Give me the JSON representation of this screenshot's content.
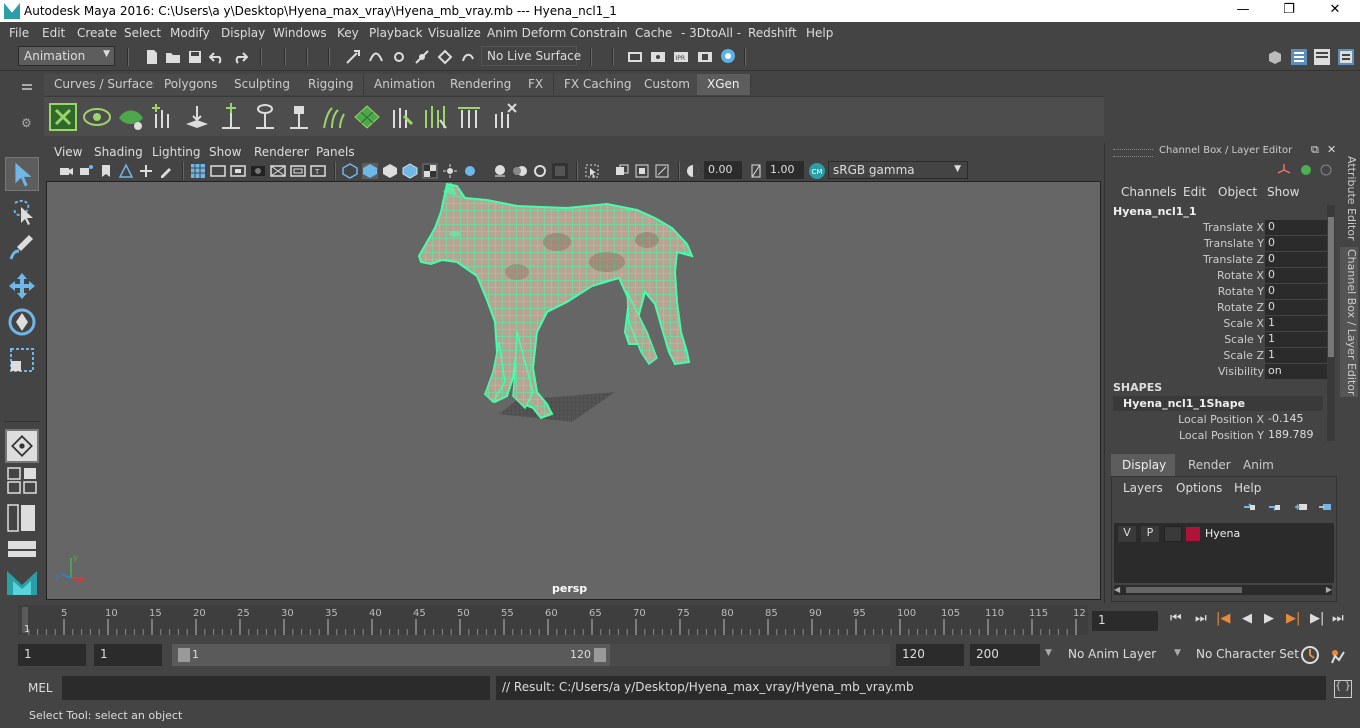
{
  "window": {
    "title": "Autodesk Maya 2016: C:\\Users\\a y\\Desktop\\Hyena_max_vray\\Hyena_mb_vray.mb   ---   Hyena_ncl1_1",
    "minimize": "—",
    "maximize": "❐",
    "close": "✕"
  },
  "menubar": {
    "items": [
      "File",
      "Edit",
      "Create",
      "Select",
      "Modify",
      "Display",
      "Windows",
      "Key",
      "Playback",
      "Visualize",
      "Anim Deform",
      "Constrain",
      "Cache",
      "- 3DtoAll -",
      "Redshift",
      "Help"
    ]
  },
  "statusline": {
    "menuset": "Animation",
    "live_surface": "No Live Surface"
  },
  "shelf": {
    "tabs": [
      "Curves / Surfaces",
      "Polygons",
      "Sculpting",
      "Rigging",
      "Animation",
      "Rendering",
      "FX",
      "FX Caching",
      "Custom",
      "XGen"
    ],
    "active_tab": "XGen",
    "accent_color": "#9cd36a"
  },
  "viewport": {
    "menu": [
      "View",
      "Shading",
      "Lighting",
      "Show",
      "Renderer",
      "Panels"
    ],
    "exposure": "0.00",
    "gamma": "1.00",
    "color_space": "sRGB gamma",
    "camera_label": "persp",
    "wire_color": "#44ffaa"
  },
  "channel_box": {
    "header": "Channel Box / Layer Editor",
    "menu": [
      "Channels",
      "Edit",
      "Object",
      "Show"
    ],
    "object_name": "Hyena_ncl1_1",
    "channels": [
      {
        "label": "Translate X",
        "value": "0"
      },
      {
        "label": "Translate Y",
        "value": "0"
      },
      {
        "label": "Translate Z",
        "value": "0"
      },
      {
        "label": "Rotate X",
        "value": "0"
      },
      {
        "label": "Rotate Y",
        "value": "0"
      },
      {
        "label": "Rotate Z",
        "value": "0"
      },
      {
        "label": "Scale X",
        "value": "1"
      },
      {
        "label": "Scale Y",
        "value": "1"
      },
      {
        "label": "Scale Z",
        "value": "1"
      },
      {
        "label": "Visibility",
        "value": "on"
      }
    ],
    "shapes_header": "SHAPES",
    "shape_name": "Hyena_ncl1_1Shape",
    "shape_channels": [
      {
        "label": "Local Position X",
        "value": "-0.145"
      },
      {
        "label": "Local Position Y",
        "value": "189.789"
      }
    ]
  },
  "layer_editor": {
    "tabs": [
      "Display",
      "Render",
      "Anim"
    ],
    "active_tab": "Display",
    "menu": [
      "Layers",
      "Options",
      "Help"
    ],
    "layer": {
      "v": "V",
      "p": "P",
      "name": "Hyena",
      "color": "#b0123a"
    }
  },
  "side_tabs": [
    "Attribute Editor",
    "Channel Box / Layer Editor"
  ],
  "timeline": {
    "ticks": [
      "5",
      "10",
      "15",
      "20",
      "25",
      "30",
      "35",
      "40",
      "45",
      "50",
      "55",
      "60",
      "65",
      "70",
      "75",
      "80",
      "85",
      "90",
      "95",
      "100",
      "105",
      "110",
      "115",
      "12"
    ],
    "start_label": "1",
    "current_frame": "1"
  },
  "range": {
    "start": "1",
    "start_inner": "1",
    "slider_start": "1",
    "slider_end": "120",
    "end": "120",
    "end_outer": "200",
    "anim_layer": "No Anim Layer",
    "character_set": "No Character Set"
  },
  "command": {
    "lang": "MEL",
    "result": "// Result: C:/Users/a y/Desktop/Hyena_max_vray/Hyena_mb_vray.mb"
  },
  "help_line": "Select Tool: select an object"
}
